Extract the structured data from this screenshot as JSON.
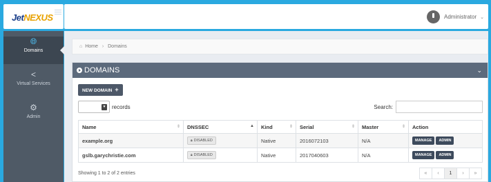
{
  "brand": {
    "logo_j": "Jet",
    "logo_n": "NEXUS"
  },
  "header": {
    "user_name": "Administrator"
  },
  "sidebar": {
    "items": [
      {
        "label": "Domains",
        "icon": "globe-icon",
        "active": true
      },
      {
        "label": "Virtual Services",
        "icon": "share-icon",
        "active": false
      },
      {
        "label": "Admin",
        "icon": "gear-icon",
        "active": false
      }
    ]
  },
  "breadcrumb": {
    "home": "Home",
    "current": "Domains"
  },
  "panel": {
    "title": "DOMAINS",
    "new_button": "NEW DOMAIN",
    "records_label": "records",
    "search_label": "Search:",
    "search_placeholder": ""
  },
  "table": {
    "columns": [
      "Name",
      "DNSSEC",
      "Kind",
      "Serial",
      "Master",
      "Action"
    ],
    "rows": [
      {
        "name": "example.org",
        "dnssec": "DISABLED",
        "kind": "Native",
        "serial": "2016072103",
        "master": "N/A",
        "manage": "MANAGE",
        "admin": "ADMIN"
      },
      {
        "name": "gslb.garychristie.com",
        "dnssec": "DISABLED",
        "kind": "Native",
        "serial": "2017040603",
        "master": "N/A",
        "manage": "MANAGE",
        "admin": "ADMIN"
      }
    ]
  },
  "footer": {
    "info": "Showing 1 to 2 of 2 entries",
    "pager": [
      "«",
      "‹",
      "1",
      "›",
      "»"
    ],
    "current_page": "1"
  },
  "colors": {
    "accent": "#2aa9e0",
    "sidebar": "#4f5a66",
    "panel_header": "#5c6a7c",
    "button": "#3d4a5c"
  }
}
